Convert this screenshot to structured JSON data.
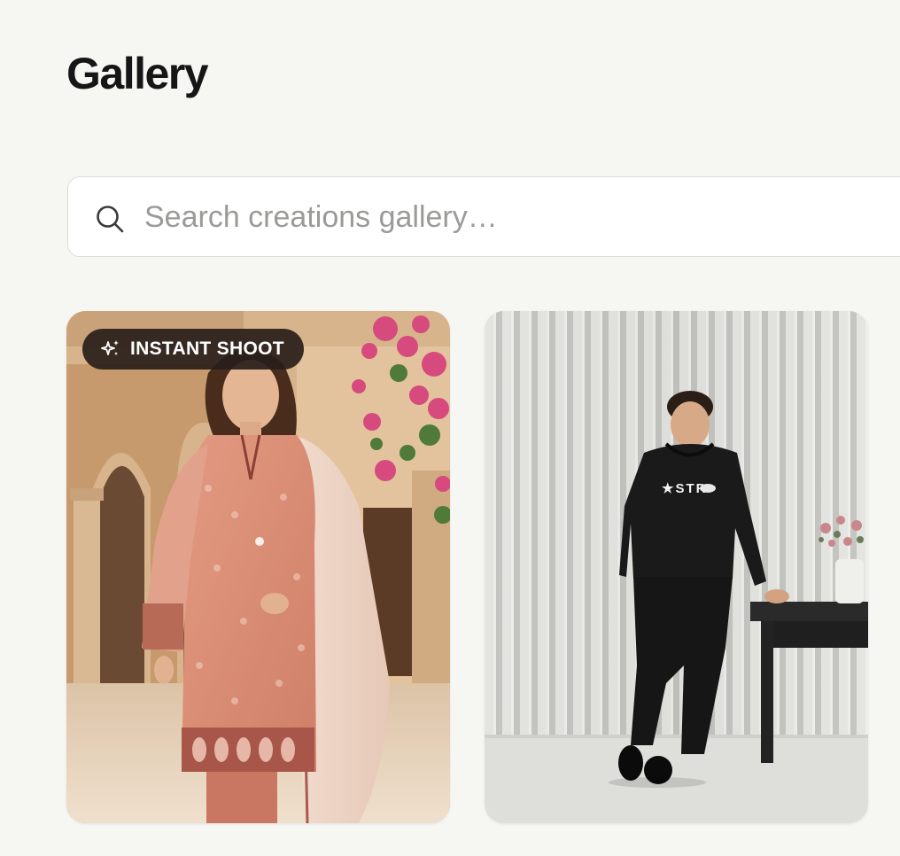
{
  "page": {
    "title": "Gallery"
  },
  "search": {
    "placeholder": "Search creations gallery…",
    "value": "",
    "icon": "search-icon"
  },
  "gallery": {
    "items": [
      {
        "badge": {
          "label": "INSTANT SHOOT",
          "icon": "sparkles-icon"
        },
        "image": "model-in-peach-printed-kurta-with-dupatta"
      },
      {
        "badge": null,
        "image": "model-in-black-hoodie-leaning-on-table"
      }
    ]
  },
  "colors": {
    "background": "#f6f6f2",
    "title": "#161616",
    "badge_bg": "#2a1f1b",
    "placeholder": "#9a9a98"
  }
}
